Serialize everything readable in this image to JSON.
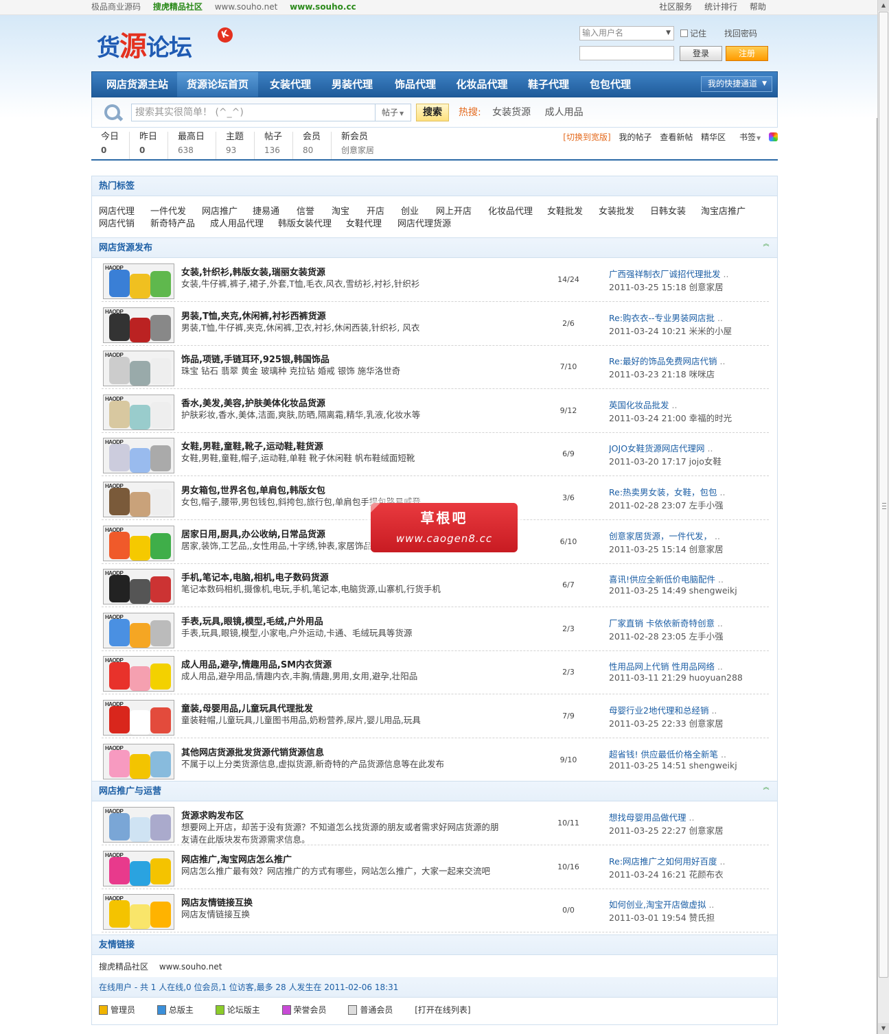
{
  "topbar": {
    "left": [
      "极品商业源码",
      "搜虎精品社区",
      "www.souho.net",
      "www.souho.cc"
    ],
    "right": [
      "社区服务",
      "统计排行",
      "帮助"
    ]
  },
  "logo": {
    "text_a": "货",
    "text_b": "源",
    "text_c": "论坛",
    "badge": "K"
  },
  "login": {
    "username_placeholder": "输入用户名",
    "remember": "记住",
    "forgot": "找回密码",
    "login_btn": "登录",
    "register_btn": "注册"
  },
  "nav": {
    "items": [
      "网店货源主站",
      "货源论坛首页",
      "女装代理",
      "男装代理",
      "饰品代理",
      "化妆品代理",
      "鞋子代理",
      "包包代理"
    ],
    "active": 1,
    "quick": "我的快捷通道"
  },
  "search": {
    "placeholder": "搜索其实很简单！ (^_^)",
    "type": "帖子",
    "button": "搜索",
    "hot_label": "热搜:",
    "hot": [
      "女装货源",
      "成人用品"
    ]
  },
  "stats": {
    "items": [
      {
        "k": "今日",
        "v": "0"
      },
      {
        "k": "昨日",
        "v": "0"
      },
      {
        "k": "最高日",
        "v": "638"
      },
      {
        "k": "主题",
        "v": "93"
      },
      {
        "k": "帖子",
        "v": "136"
      },
      {
        "k": "会员",
        "v": "80"
      },
      {
        "k": "新会员",
        "v": "创意家居"
      }
    ],
    "links": {
      "wide": "[切换到宽版]",
      "mine": "我的帖子",
      "new": "查看新帖",
      "digest": "精华区",
      "bookmark": "书签"
    }
  },
  "tags": {
    "title": "热门标签",
    "row1": [
      "网店代理",
      "一件代发",
      "网店推广",
      "捷易通",
      "信誉",
      "淘宝",
      "开店",
      "创业",
      "网上开店",
      "化妆品代理",
      "女鞋批发",
      "女装批发",
      "日韩女装",
      "淘宝店推广"
    ],
    "row2": [
      "网店代销",
      "新奇特产品",
      "成人用品代理",
      "韩版女装代理",
      "女鞋代理",
      "网店代理货源"
    ]
  },
  "forum1": {
    "title": "网店货源发布",
    "rows": [
      {
        "name": "女装,针织衫,韩版女装,瑞丽女装货源",
        "desc": "女装,牛仔裤,裤子,裙子,外套,T恤,毛衣,风衣,雪纺衫,衬衫,针织衫",
        "count": "14/24",
        "last_title": "广西强祥制衣厂诚招代理批发",
        "last_meta": "2011-03-25 15:18 创意家居"
      },
      {
        "name": "男装,T恤,夹克,休闲裤,衬衫西裤货源",
        "desc": "男装,T恤,牛仔裤,夹克,休闲裤,卫衣,衬衫,休闲西装,针织衫, 风衣",
        "count": "2/6",
        "last_title": "Re:购衣衣--专业男装网店批",
        "last_meta": "2011-03-24 10:21 米米的小屋"
      },
      {
        "name": "饰品,项链,手链耳环,925银,韩国饰品",
        "desc": "珠宝 钻石 翡翠 黄金 玻璃种 克拉钻 婚戒 银饰 施华洛世奇",
        "count": "7/10",
        "last_title": "Re:最好的饰品免费网店代销",
        "last_meta": "2011-03-23 21:18 咪咪店"
      },
      {
        "name": "香水,美发,美容,护肤美体化妆品货源",
        "desc": "护肤彩妆,香水,美体,洁面,爽肤,防晒,隔离霜,精华,乳液,化妆水等",
        "count": "9/12",
        "last_title": "英国化妆品批发",
        "last_meta": "2011-03-24 21:00 幸福的时光"
      },
      {
        "name": "女鞋,男鞋,童鞋,靴子,运动鞋,鞋货源",
        "desc": "女鞋,男鞋,童鞋,帽子,运动鞋,单鞋 靴子休闲鞋 帆布鞋绒面短靴",
        "count": "6/9",
        "last_title": "JOJO女鞋货源网店代理网",
        "last_meta": "2011-03-20 17:17 jojo女鞋"
      },
      {
        "name": "男女箱包,世界名包,单肩包,韩版女包",
        "desc": "女包,帽子,腰带,男包钱包,斜挎包,旅行包,单肩包手提包路易威登",
        "count": "3/6",
        "last_title": "Re:热卖男女装，女鞋，包包",
        "last_meta": "2011-02-28 23:07 左手小强"
      },
      {
        "name": "居家日用,厨具,办公收纳,日常品货源",
        "desc": "居家,装饰,工艺品,,女性用品,十字绣,钟表,家居饰品,家",
        "count": "6/10",
        "last_title": "创意家居货源，一件代发，",
        "last_meta": "2011-03-25 15:14 创意家居"
      },
      {
        "name": "手机,笔记本,电脑,相机,电子数码货源",
        "desc": "笔记本数码相机,摄像机,电玩,手机,笔记本,电脑货源,山寨机,行货手机",
        "count": "6/7",
        "last_title": "喜讯!供应全新低价电脑配件",
        "last_meta": "2011-03-25 14:49 shengweikj"
      },
      {
        "name": "手表,玩具,眼镜,模型,毛绒,户外用品",
        "desc": "手表,玩具,眼镜,模型,小家电,户外运动,卡通、毛绒玩具等货源",
        "count": "2/3",
        "last_title": "厂家直销 卡依依新奇特创意",
        "last_meta": "2011-02-28 23:05 左手小强"
      },
      {
        "name": "成人用品,避孕,情趣用品,SM内衣货源",
        "desc": "成人用品,避孕用品,情趣内衣,丰胸,情趣,男用,女用,避孕,壮阳品",
        "count": "2/3",
        "last_title": "性用品网上代销 性用品网络",
        "last_meta": "2011-03-11 21:29 huoyuan288"
      },
      {
        "name": "童装,母婴用品,儿童玩具代理批发",
        "desc": "童装鞋帽,儿童玩具,儿童图书用品,奶粉营养,尿片,婴儿用品,玩具",
        "count": "7/9",
        "last_title": "母婴行业2地代理和总经销",
        "last_meta": "2011-03-25 22:33 创意家居"
      },
      {
        "name": "其他网店货源批发货源代销货源信息",
        "desc": "不属于以上分类货源信息,虚拟货源,新奇特的产品货源信息等在此发布",
        "count": "9/10",
        "last_title": "超省钱! 供应最低价格全新笔",
        "last_meta": "2011-03-25 14:51 shengweikj"
      }
    ]
  },
  "forum2": {
    "title": "网店推广与运营",
    "rows": [
      {
        "name": "货源求购发布区",
        "desc": "想要网上开店，却苦于没有货源？不知道怎么找货源的朋友或者需求好网店货源的朋友请在此版块发布货源需求信息。",
        "count": "10/11",
        "last_title": "想找母婴用品做代理",
        "last_meta": "2011-03-25 22:27 创意家居"
      },
      {
        "name": "网店推广,淘宝网店怎么推广",
        "desc": "网店怎么推广最有效？网店推广的方式有哪些，网站怎么推广，大家一起来交流吧",
        "count": "10/16",
        "last_title": "Re:网店推广之如何用好百度",
        "last_meta": "2011-03-24 16:21 花颜布衣"
      },
      {
        "name": "网店友情链接互换",
        "desc": "网店友情链接互换",
        "count": "0/0",
        "last_title": "如何创业,淘宝开店做虚拟",
        "last_meta": "2011-03-01 19:54 赞氏担"
      }
    ]
  },
  "friend_links": {
    "title": "友情链接",
    "items": [
      "搜虎精品社区",
      "www.souho.net"
    ]
  },
  "online": {
    "summary": "在线用户 - 共 1 人在线,0 位会员,1 位访客,最多 28 人发生在 2011-02-06 18:31",
    "legend": [
      "管理员",
      "总版主",
      "论坛版主",
      "荣誉会员",
      "普通会员"
    ],
    "open_list": "[打开在线列表]"
  },
  "watermark": {
    "a": "草根吧",
    "b": "www.caogen8.cc"
  },
  "colors": {
    "accent": "#1d5fa5",
    "nav": "#2b69a6",
    "hot": "#e46a1e",
    "register": "#ff9a00"
  }
}
